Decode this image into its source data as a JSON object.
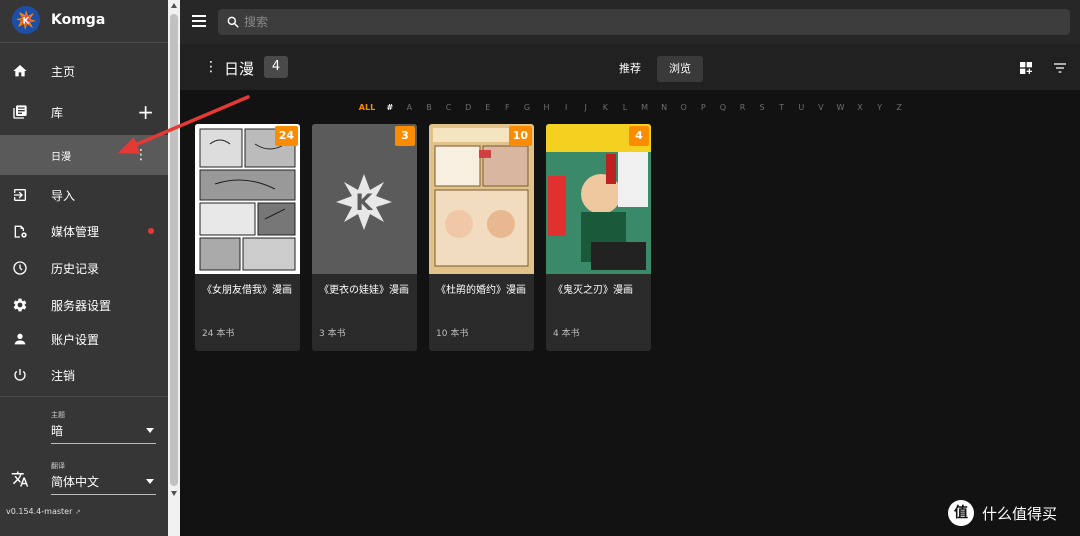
{
  "brand": {
    "name": "Komga"
  },
  "sidebar": {
    "items": [
      {
        "label": "主页",
        "icon": "home-icon"
      },
      {
        "label": "库",
        "icon": "library-icon"
      },
      {
        "label": "日漫",
        "icon": ""
      },
      {
        "label": "导入",
        "icon": "import-icon"
      },
      {
        "label": "媒体管理",
        "icon": "media-management-icon"
      },
      {
        "label": "历史记录",
        "icon": "history-icon"
      },
      {
        "label": "服务器设置",
        "icon": "gear-icon"
      },
      {
        "label": "账户设置",
        "icon": "account-icon"
      },
      {
        "label": "注销",
        "icon": "power-icon"
      }
    ],
    "theme": {
      "caption": "主题",
      "value": "暗"
    },
    "language": {
      "caption": "翻译",
      "value": "简体中文"
    },
    "version": "v0.154.4-master"
  },
  "search": {
    "placeholder": "搜索"
  },
  "toolbar": {
    "title": "日漫",
    "count": "4",
    "tabs": [
      "推荐",
      "浏览"
    ],
    "active_tab": "浏览"
  },
  "alphabet": [
    "ALL",
    "#",
    "A",
    "B",
    "C",
    "D",
    "E",
    "F",
    "G",
    "H",
    "I",
    "J",
    "K",
    "L",
    "M",
    "N",
    "O",
    "P",
    "Q",
    "R",
    "S",
    "T",
    "U",
    "V",
    "W",
    "X",
    "Y",
    "Z"
  ],
  "series": [
    {
      "title": "《女朋友借我》漫画",
      "count": "24",
      "books": "24 本书"
    },
    {
      "title": "《更衣の娃娃》漫画",
      "count": "3",
      "books": "3 本书"
    },
    {
      "title": "《杜鹃的婚约》漫画",
      "count": "10",
      "books": "10 本书"
    },
    {
      "title": "《鬼灭之刃》漫画",
      "count": "4",
      "books": "4 本书"
    }
  ],
  "colors": {
    "accent": "#fb8c00",
    "sidebar": "#363636",
    "background": "#121212",
    "annotation": "#e53935"
  },
  "watermark": {
    "text": "什么值得买",
    "logo": "值"
  }
}
